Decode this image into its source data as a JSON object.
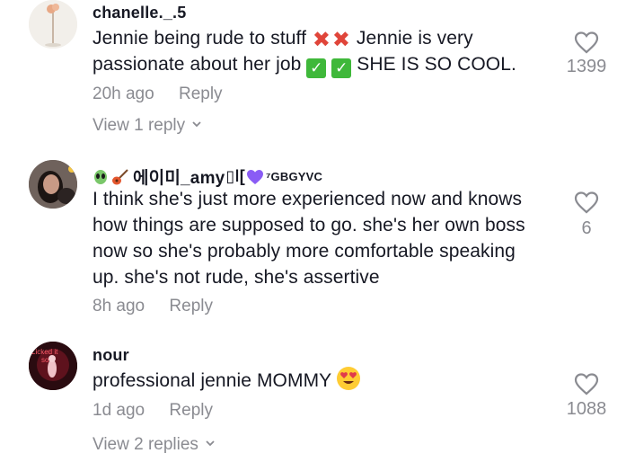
{
  "comments": [
    {
      "username": "chanelle._.5",
      "body_parts": [
        "Jennie being rude to stuff ",
        " Jennie is very",
        "passionate about her job ",
        " SHE IS SO COOL."
      ],
      "time": "20h ago",
      "reply_label": "Reply",
      "likes": "1399",
      "view_replies": "View 1 reply"
    },
    {
      "username": "에이미_amy",
      "username_suffix": "⁷GBGYVC",
      "body_lines": [
        "I think she's just more experienced now and knows",
        "how things are supposed to go. she's her own boss",
        "now so she's probably more comfortable speaking",
        "up. she's not rude, she's assertive"
      ],
      "time": "8h ago",
      "reply_label": "Reply",
      "likes": "6"
    },
    {
      "username": "nour",
      "body": "professional jennie MOMMY ",
      "time": "1d ago",
      "reply_label": "Reply",
      "likes": "1088",
      "view_replies": "View 2 replies",
      "avatar_text": [
        "Licked it",
        "so"
      ]
    }
  ],
  "colors": {
    "text": "#161823",
    "muted": "#8a8b91",
    "cross": "#e0453a",
    "check": "#3fb83a",
    "heart_emoji": "#8a5cf5"
  },
  "icons": [
    "heart-outline-icon",
    "chevron-down-icon",
    "cross-mark-icon",
    "check-mark-box-icon",
    "alien-icon",
    "guitar-icon",
    "purple-heart-icon",
    "heart-eyes-face-icon"
  ]
}
